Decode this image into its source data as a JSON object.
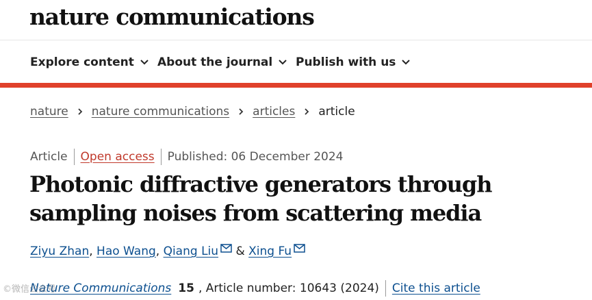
{
  "site": {
    "logo_text": "nature communications"
  },
  "nav": {
    "items": [
      {
        "label": "Explore content"
      },
      {
        "label": "About the journal"
      },
      {
        "label": "Publish with us"
      }
    ]
  },
  "breadcrumb": [
    "nature",
    "nature communications",
    "articles",
    "article"
  ],
  "article": {
    "type": "Article",
    "access": "Open access",
    "published": "Published: 06 December 2024",
    "title": "Photonic diffractive generators through sampling noises from scattering media",
    "authors": [
      {
        "name": "Ziyu Zhan",
        "sep": ","
      },
      {
        "name": "Hao Wang",
        "sep": ","
      },
      {
        "name": "Qiang Liu",
        "sep": "&"
      },
      {
        "name": "Xing Fu",
        "sep": ""
      }
    ],
    "journal": "Nature Communications",
    "volume": "15",
    "article_number": ", Article number: 10643 (2024)",
    "cite_label": "Cite this article"
  },
  "watermark_text": "©微信公众号",
  "colors": {
    "accent_red": "#e0412b",
    "link_blue": "#0c4f8f",
    "open_access": "#c0392b"
  }
}
